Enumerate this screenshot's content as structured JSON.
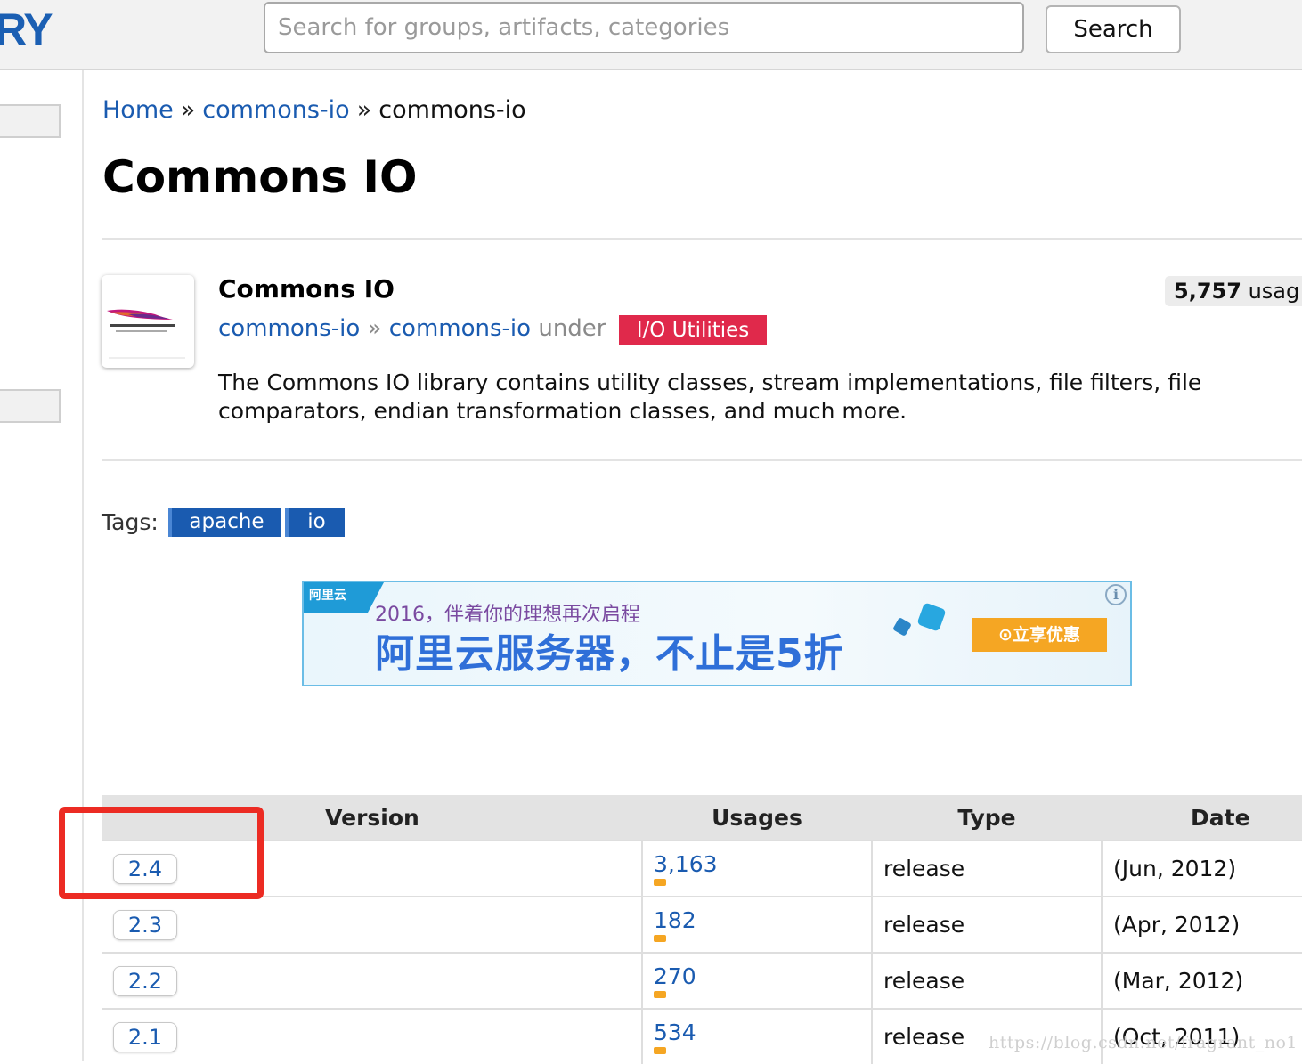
{
  "header": {
    "logo_text": "RY",
    "search_placeholder": "Search for groups, artifacts, categories",
    "search_button": "Search"
  },
  "breadcrumb": {
    "home": "Home",
    "group": "commons-io",
    "separator": "»",
    "current": "commons-io"
  },
  "page_title": "Commons IO",
  "artifact": {
    "name": "Commons IO",
    "usages_count": "5,757",
    "usages_label": "usag",
    "group_link": "commons-io",
    "arrow": "»",
    "artifact_link": "commons-io",
    "under_label": "under",
    "category": "I/O Utilities",
    "description": "The Commons IO library contains utility classes, stream implementations, file filters, file comparators, endian transformation classes, and much more."
  },
  "tags": {
    "label": "Tags:",
    "items": [
      "apache",
      "io"
    ]
  },
  "ad": {
    "brand": "阿里云",
    "line1": "2016，伴着你的理想再次启程",
    "line2": "阿里云服务器，不止是5折",
    "cta": "⊙立享优惠",
    "info_icon": "i",
    "colors": {
      "headline": "#2f6fd8",
      "cta": "#f5a623",
      "border": "#6bbde6"
    }
  },
  "versions_table": {
    "headers": [
      "Version",
      "Usages",
      "Type",
      "Date"
    ],
    "rows": [
      {
        "version": "2.4",
        "usages": "3,163",
        "type": "release",
        "date": "(Jun, 2012)"
      },
      {
        "version": "2.3",
        "usages": "182",
        "type": "release",
        "date": "(Apr, 2012)"
      },
      {
        "version": "2.2",
        "usages": "270",
        "type": "release",
        "date": "(Mar, 2012)"
      },
      {
        "version": "2.1",
        "usages": "534",
        "type": "release",
        "date": "(Oct, 2011)"
      }
    ]
  },
  "annotation": {
    "highlight_color": "#ec2b23",
    "highlighted_version": "2.4"
  },
  "watermark": "https://blog.csdn.net/fragrant_no1",
  "colors": {
    "link": "#1a5bb0",
    "category_tag": "#e0294b",
    "tag": "#1a5bb0",
    "usage_bar": "#f5a623"
  }
}
